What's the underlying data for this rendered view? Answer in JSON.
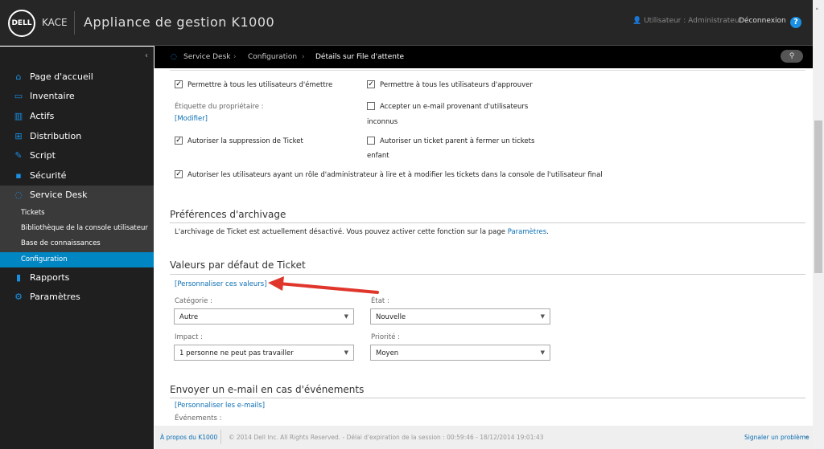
{
  "header": {
    "logo": "DELL",
    "brand": "KACE",
    "title": "Appliance de gestion K1000",
    "user": "Utilisateur : Administrateur",
    "logout": "Déconnexion",
    "help": "?"
  },
  "sidebar": {
    "items": [
      {
        "label": "Page d'accueil",
        "icon": "home-icon",
        "glyph": "⌂"
      },
      {
        "label": "Inventaire",
        "icon": "monitor-icon",
        "glyph": "▭"
      },
      {
        "label": "Actifs",
        "icon": "assets-icon",
        "glyph": "▥"
      },
      {
        "label": "Distribution",
        "icon": "distribution-icon",
        "glyph": "⊞"
      },
      {
        "label": "Script",
        "icon": "script-icon",
        "glyph": "✎"
      },
      {
        "label": "Sécurité",
        "icon": "lock-icon",
        "glyph": "▪"
      },
      {
        "label": "Service Desk",
        "icon": "service-desk-icon",
        "glyph": "◌"
      },
      {
        "label": "Rapports",
        "icon": "reports-icon",
        "glyph": "▮"
      },
      {
        "label": "Paramètres",
        "icon": "gear-icon",
        "glyph": "⚙"
      }
    ],
    "subitems": [
      "Tickets",
      "Bibliothèque de la console utilisateur",
      "Base de connaissances",
      "Configuration"
    ]
  },
  "breadcrumb": [
    "Service Desk",
    "Configuration",
    "Détails sur File d'attente"
  ],
  "main": {
    "cb1": "Permettre à tous les utilisateurs d'émettre",
    "cb2": "Permettre à tous les utilisateurs d'approuver",
    "owner_label": "Étiquette du propriétaire :",
    "owner_link": "[Modifier]",
    "cb3": "Accepter un e-mail provenant d'utilisateurs",
    "cb3b": "inconnus",
    "cb4": "Autoriser la suppression de Ticket",
    "cb5": "Autoriser un ticket parent à fermer un tickets",
    "cb5b": "enfant",
    "cb6": "Autoriser les utilisateurs ayant un rôle d'administrateur à lire et à modifier les tickets dans la console de l'utilisateur final",
    "archive_title": "Préférences d'archivage",
    "archive_text": "L'archivage de Ticket est actuellement désactivé. Vous pouvez activer cette fonction sur la page",
    "archive_link": "Paramètres",
    "archive_end": ".",
    "defaults_title": "Valeurs par défaut de Ticket",
    "defaults_link": "[Personnaliser ces valeurs]",
    "category_label": "Catégorie :",
    "category": "Autre",
    "state_label": "État :",
    "state": "Nouvelle",
    "impact_label": "Impact :",
    "impact": "1 personne ne peut pas travailler",
    "priority_label": "Priorité :",
    "priority": "Moyen",
    "email_title": "Envoyer un e-mail en cas d'événements",
    "email_link": "[Personnaliser les e-mails]",
    "events_label": "Événements :"
  },
  "footer": {
    "about": "À propos du K1000",
    "copyright": "© 2014 Dell Inc. All Rights Reserved. - Délai d'expiration de la session : 00:59:46 - 18/12/2014 19:01:43",
    "report": "Signaler un problème"
  },
  "colors": {
    "accent": "#0086c3",
    "arrow": "#e0352b"
  }
}
